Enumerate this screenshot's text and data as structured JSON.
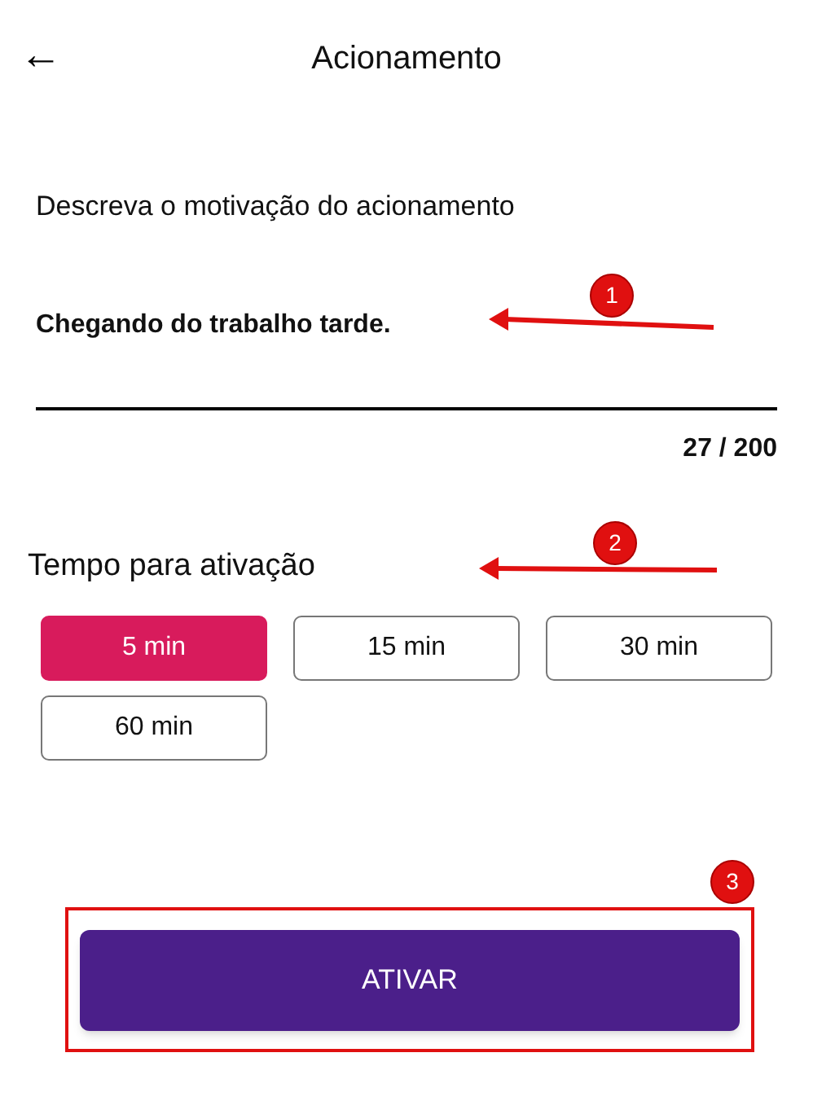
{
  "header": {
    "back": "←",
    "title": "Acionamento"
  },
  "motivation": {
    "label": "Descreva o motivação do acionamento",
    "value": "Chegando do trabalho tarde.",
    "counter": "27 / 200"
  },
  "timing": {
    "title": "Tempo para ativação",
    "options": [
      {
        "label": "5 min",
        "selected": true
      },
      {
        "label": "15 min",
        "selected": false
      },
      {
        "label": "30 min",
        "selected": false
      },
      {
        "label": "60 min",
        "selected": false
      }
    ]
  },
  "activate_button": "ATIVAR",
  "annotations": [
    {
      "number": "1"
    },
    {
      "number": "2"
    },
    {
      "number": "3"
    }
  ]
}
